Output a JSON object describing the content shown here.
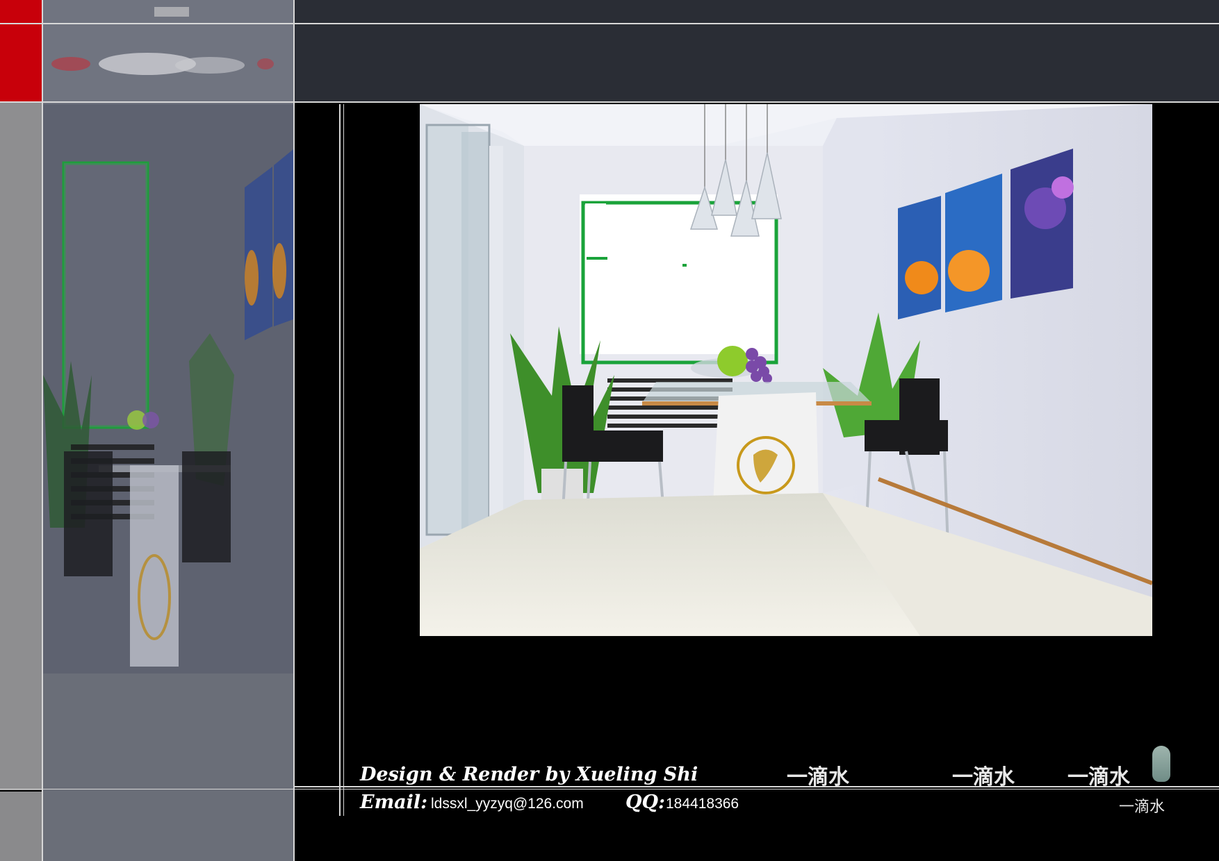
{
  "colors": {
    "red_strip": "#c8000a",
    "grey_strip": "#8e8e90",
    "header_bg": "#2a2d35",
    "page_bg": "#000000",
    "rule": "#d8d8d8"
  },
  "footer": {
    "design_credit": "Design & Render by Xueling Shi",
    "email_label": "Email:",
    "email_value": "ldssxl_yyzyq@126.com",
    "qq_label": "QQ:",
    "qq_value": "184418366",
    "brand_1": "一滴水",
    "brand_2": "一滴水",
    "brand_3": "一滴水",
    "brand_small": "一滴水"
  }
}
